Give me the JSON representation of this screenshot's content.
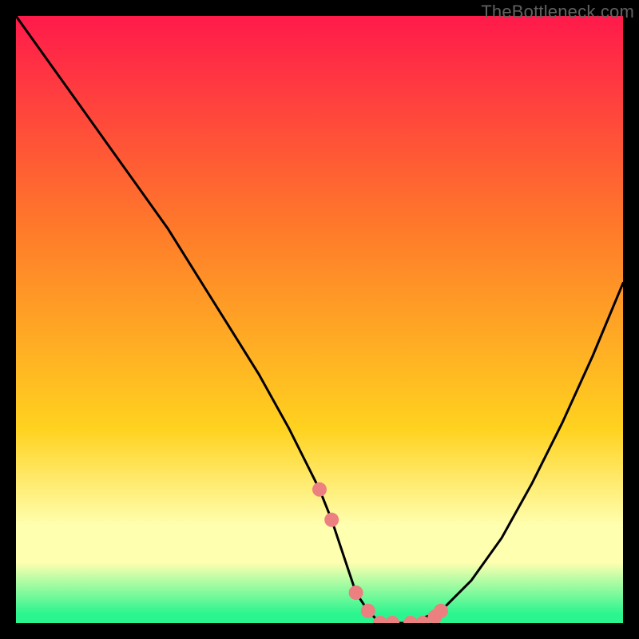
{
  "watermark": "TheBottleneck.com",
  "colors": {
    "top": "#ff1a4b",
    "mid1": "#ff7a2a",
    "mid2": "#ffd21f",
    "pale": "#ffffb0",
    "green": "#2bf58f",
    "frame": "#000000",
    "curve": "#000000",
    "marker": "#ec7f80"
  },
  "chart_data": {
    "type": "line",
    "title": "",
    "xlabel": "",
    "ylabel": "",
    "xlim": [
      0,
      100
    ],
    "ylim": [
      0,
      100
    ],
    "x": [
      0,
      5,
      10,
      15,
      20,
      25,
      30,
      35,
      40,
      45,
      50,
      52,
      54,
      56,
      58,
      60,
      62,
      65,
      70,
      75,
      80,
      85,
      90,
      95,
      100
    ],
    "values": [
      100,
      93,
      86,
      79,
      72,
      65,
      57,
      49,
      41,
      32,
      22,
      17,
      11,
      5,
      2,
      0,
      0,
      0,
      2,
      7,
      14,
      23,
      33,
      44,
      56
    ],
    "markers_x": [
      50,
      52,
      56,
      58,
      60,
      62,
      65,
      67,
      69,
      70
    ],
    "markers_y": [
      22,
      17,
      5,
      2,
      0,
      0,
      0,
      0,
      1,
      2
    ]
  }
}
